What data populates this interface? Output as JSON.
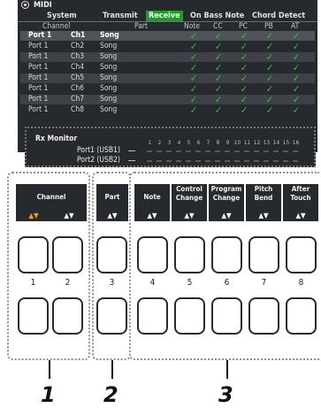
{
  "screen": {
    "title": "MIDI",
    "tabs": [
      {
        "label": "System",
        "active": false
      },
      {
        "label": "Transmit",
        "active": false
      },
      {
        "label": "Receive",
        "active": true
      },
      {
        "label": "On Bass Note",
        "active": false
      },
      {
        "label": "Chord Detect",
        "active": false
      }
    ],
    "headers": {
      "channel": "Channel",
      "part": "Part",
      "note": "Note",
      "cc": "CC",
      "pc": "PC",
      "pb": "PB",
      "at": "AT"
    },
    "rows": [
      {
        "port": "Port 1",
        "ch": "Ch1",
        "part": "Song",
        "selected": true
      },
      {
        "port": "Port 1",
        "ch": "Ch2",
        "part": "Song"
      },
      {
        "port": "Port 1",
        "ch": "Ch3",
        "part": "Song"
      },
      {
        "port": "Port 1",
        "ch": "Ch4",
        "part": "Song"
      },
      {
        "port": "Port 1",
        "ch": "Ch5",
        "part": "Song"
      },
      {
        "port": "Port 1",
        "ch": "Ch6",
        "part": "Song"
      },
      {
        "port": "Port 1",
        "ch": "Ch7",
        "part": "Song"
      },
      {
        "port": "Port 1",
        "ch": "Ch8",
        "part": "Song"
      }
    ],
    "check_glyph": "✓",
    "rx_monitor": {
      "title": "Rx Monitor",
      "channels": [
        "1",
        "2",
        "3",
        "4",
        "5",
        "6",
        "7",
        "8",
        "9",
        "10",
        "11",
        "12",
        "13",
        "14",
        "15",
        "16"
      ],
      "ports": [
        "Port1 (USB1)",
        "Port2 (USB2)"
      ]
    }
  },
  "panel": {
    "groups": [
      {
        "id": "1",
        "labels": [
          {
            "text": "Channel",
            "arrows": "▲▼",
            "arrows_alt": "▲▼",
            "keys": [
              "1",
              "2"
            ]
          }
        ]
      },
      {
        "id": "2",
        "labels": [
          {
            "text": "Part",
            "arrows": "▲▼",
            "keys": [
              "3"
            ]
          }
        ]
      },
      {
        "id": "3",
        "labels": [
          {
            "text": "Note",
            "arrows": "▲▼",
            "key": "4"
          },
          {
            "text": "Control Change",
            "arrows": "▲▼",
            "key": "5"
          },
          {
            "text": "Program Change",
            "arrows": "▲▼",
            "key": "6"
          },
          {
            "text": "Pitch Bend",
            "arrows": "▲▼",
            "key": "7"
          },
          {
            "text": "After Touch",
            "arrows": "▲▼",
            "key": "8"
          }
        ]
      }
    ],
    "callouts": [
      "1",
      "2",
      "3"
    ]
  },
  "colors": {
    "screen_bg": "#26292e",
    "active_tab": "#1f9b2a",
    "check": "#39c232",
    "arrow_orange": "#f5a012"
  }
}
